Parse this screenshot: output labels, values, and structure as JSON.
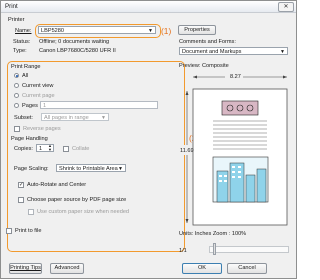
{
  "window": {
    "title": "Print"
  },
  "printer": {
    "group_label": "Printer",
    "name_label": "Name:",
    "name_value": "LBP5280",
    "properties_label": "Properties",
    "status_label": "Status:",
    "status_value": "Offline; 0 documents waiting",
    "type_label": "Type:",
    "type_value": "Canon LBP7680C/5280 UFR II"
  },
  "comments": {
    "label": "Comments and Forms:",
    "value": "Document and Markups"
  },
  "print_range": {
    "label": "Print Range",
    "all": "All",
    "current_view": "Current view",
    "current_page": "Current page",
    "pages_label": "Pages",
    "pages_value": "1",
    "subset_label": "Subset:",
    "subset_value": "All pages in range",
    "reverse": "Reverse pages"
  },
  "handling": {
    "label": "Page Handling",
    "copies_label": "Copies:",
    "copies_value": "1",
    "collate": "Collate",
    "scaling_label": "Page Scaling:",
    "scaling_value": "Shrink to Printable Area",
    "auto_rotate": "Auto-Rotate and Center",
    "choose_source": "Choose paper source by PDF page size",
    "custom_paper": "Use custom paper size when needed"
  },
  "print_to_file": "Print to file",
  "preview": {
    "label": "Preview: Composite",
    "width": "8.27",
    "height": "11.69",
    "units": "Units: Inches Zoom : 100%",
    "page": "1/1"
  },
  "buttons": {
    "tips": "Printing Tips",
    "advanced": "Advanced",
    "ok": "OK",
    "cancel": "Cancel"
  },
  "callouts": {
    "one": "(1)",
    "two": "(2)"
  },
  "colors": {
    "accent": "#f29a2e",
    "callout": "#e4701c",
    "building": "#8fd3ea",
    "header": "#d8b7c4"
  }
}
